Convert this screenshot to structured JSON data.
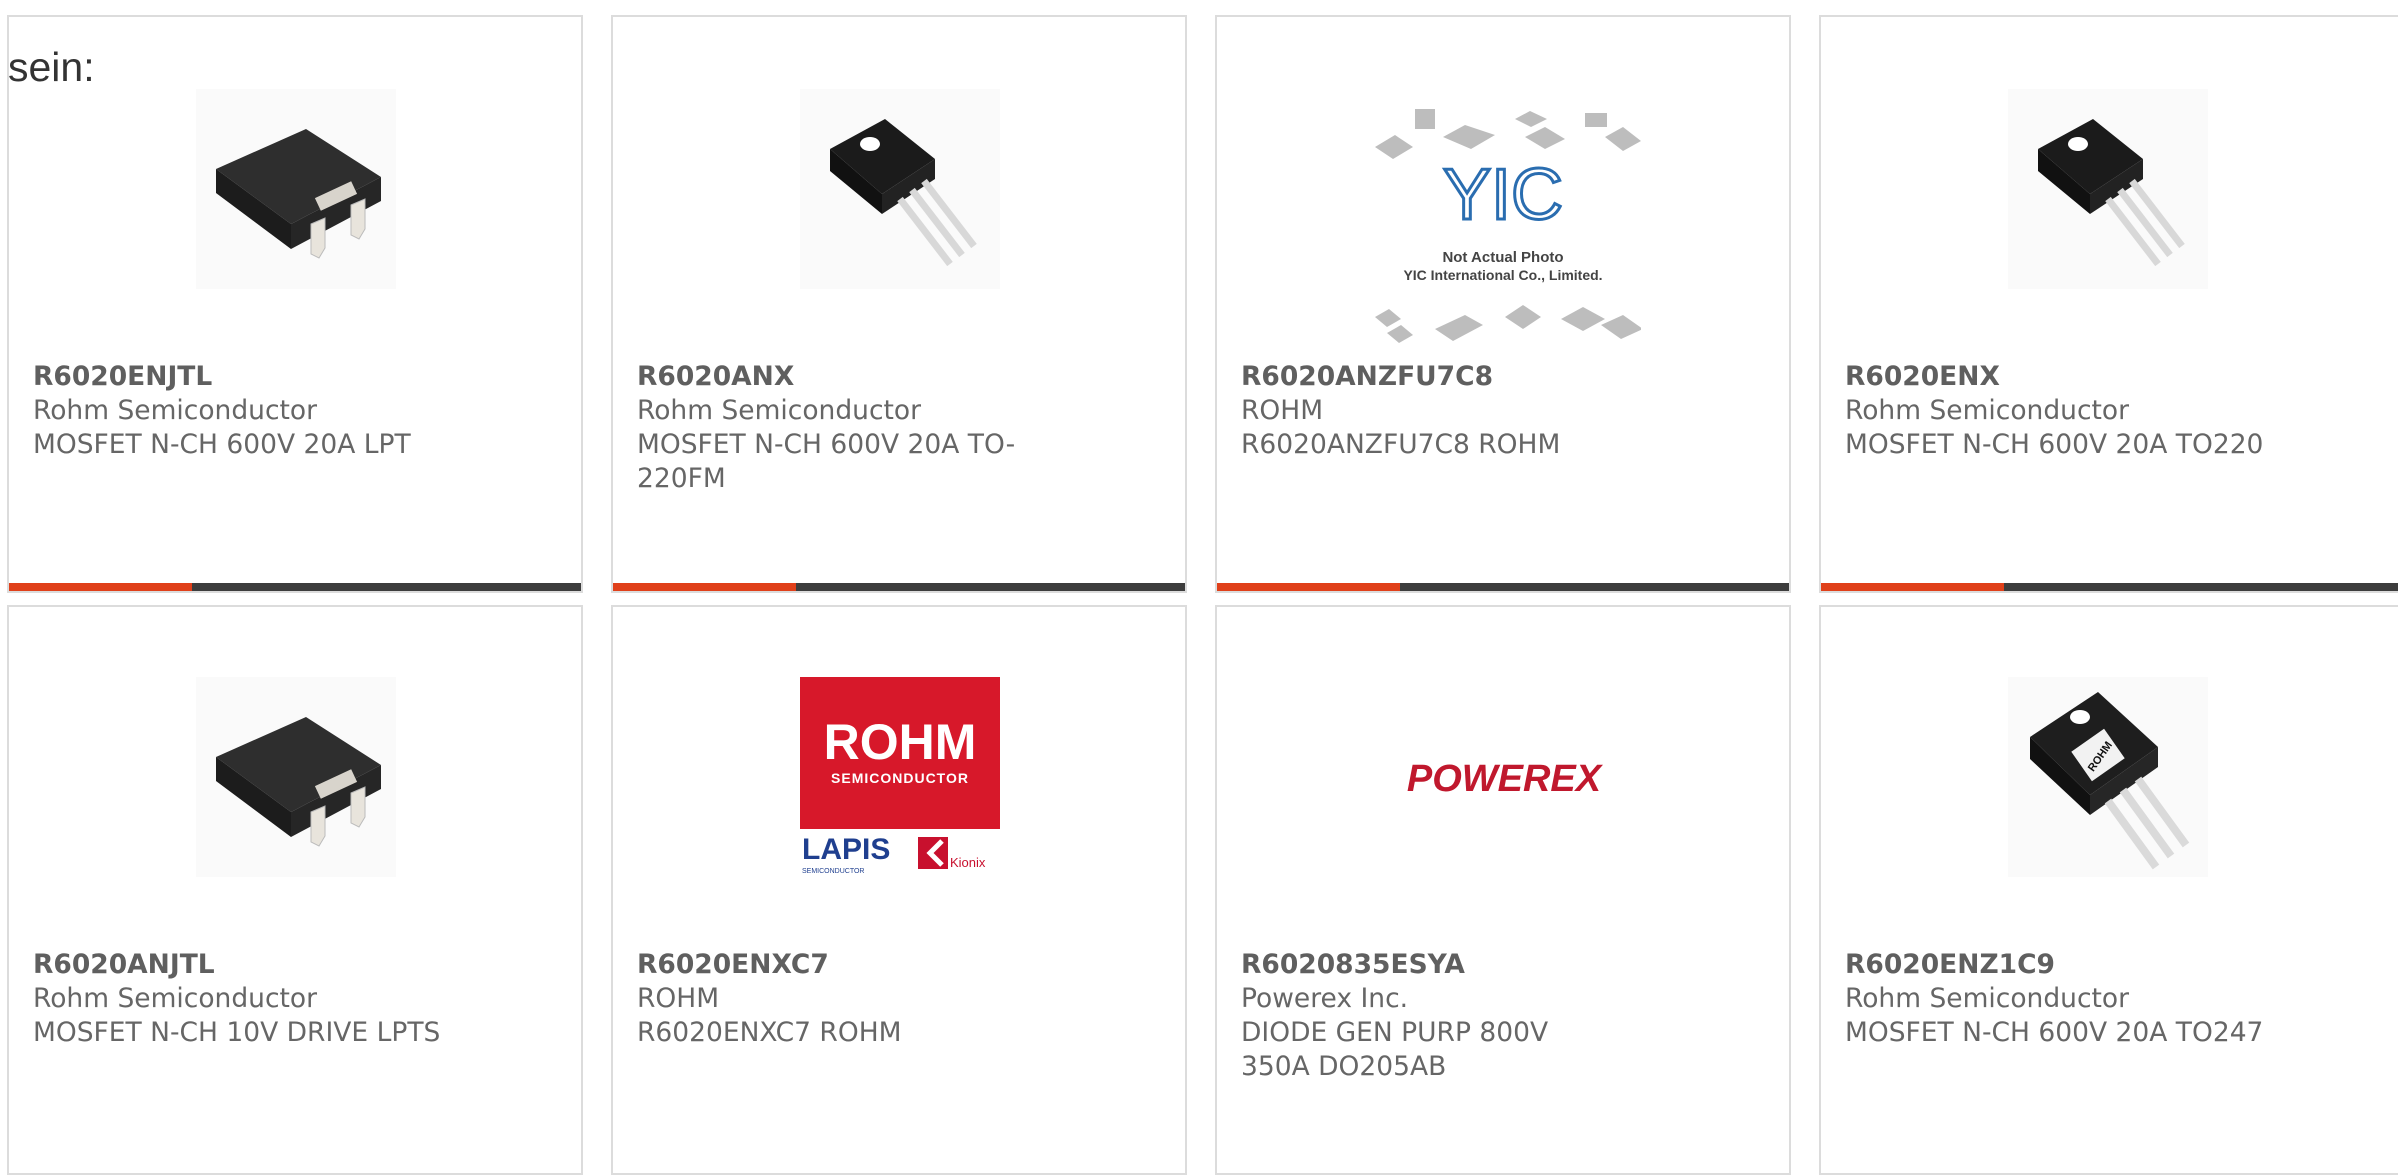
{
  "lead_text": "sein:",
  "products": [
    {
      "part": "R6020ENJTL",
      "maker": "Rohm Semiconductor",
      "desc": "MOSFET N-CH 600V 20A LPT",
      "image": "d2pak-package-icon"
    },
    {
      "part": "R6020ANX",
      "maker": "Rohm Semiconductor",
      "desc": "MOSFET N-CH 600V 20A TO-220FM",
      "image": "to220-package-icon"
    },
    {
      "part": "R6020ANZFU7C8",
      "maker": "ROHM",
      "desc": "R6020ANZFU7C8 ROHM",
      "image": "yic-placeholder-image",
      "image_text": {
        "logo": "YIC",
        "line1": "Not Actual Photo",
        "line2": "YIC International Co., Limited."
      }
    },
    {
      "part": "R6020ENX",
      "maker": "Rohm Semiconductor",
      "desc": "MOSFET N-CH 600V 20A TO220",
      "image": "to220-package-icon"
    },
    {
      "part": "R6020ANJTL",
      "maker": "Rohm Semiconductor",
      "desc": "MOSFET N-CH 10V DRIVE LPTS",
      "image": "d2pak-package-icon"
    },
    {
      "part": "R6020ENXC7",
      "maker": "ROHM",
      "desc": "R6020ENXC7 ROHM",
      "image": "rohm-logo",
      "image_text": {
        "brand": "ROHM",
        "sub": "SEMICONDUCTOR",
        "lapis": "LAPIS",
        "lapis_sub": "SEMICONDUCTOR",
        "kionix": "Kionix"
      }
    },
    {
      "part": "R6020835ESYA",
      "maker": "Powerex Inc.",
      "desc": "DIODE GEN PURP 800V 350A DO205AB",
      "image": "powerex-logo",
      "image_text": {
        "brand": "POWEREX"
      }
    },
    {
      "part": "R6020ENZ1C9",
      "maker": "Rohm Semiconductor",
      "desc": "MOSFET N-CH 600V 20A TO247",
      "image": "to247-package-icon",
      "image_text": {
        "brand": "ROHM"
      }
    }
  ],
  "colors": {
    "accent": "#e0401a",
    "bar": "#3d3d3d",
    "border": "#dcdcdc",
    "text": "#666666"
  }
}
